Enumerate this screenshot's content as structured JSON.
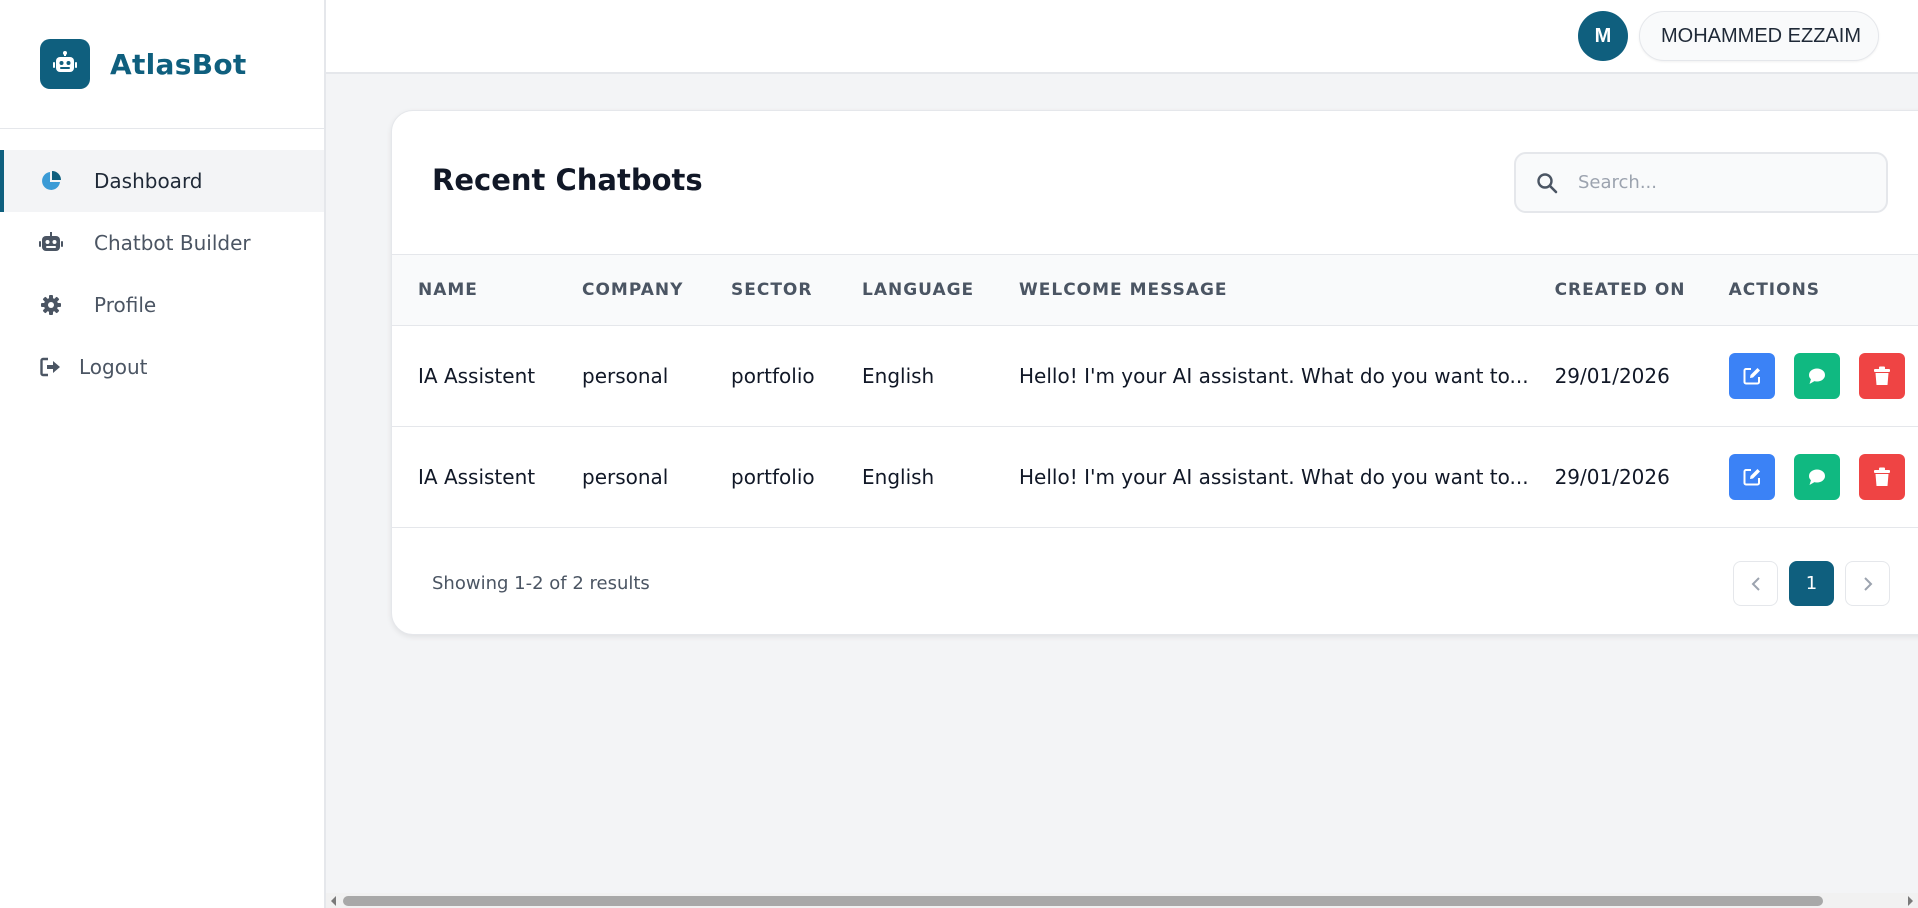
{
  "brand": {
    "name": "AtlasBot",
    "logo_icon": "robot-icon",
    "color": "#0f5f7e"
  },
  "sidebar": {
    "items": [
      {
        "label": "Dashboard",
        "icon": "pie-chart-icon",
        "active": true
      },
      {
        "label": "Chatbot Builder",
        "icon": "robot-icon",
        "active": false
      },
      {
        "label": "Profile",
        "icon": "gear-icon",
        "active": false
      },
      {
        "label": "Logout",
        "icon": "logout-icon",
        "active": false
      }
    ]
  },
  "header": {
    "avatar_initial": "M",
    "user_name": "MOHAMMED EZZAIM"
  },
  "main": {
    "title": "Recent Chatbots",
    "search": {
      "placeholder": "Search...",
      "value": ""
    },
    "table": {
      "columns": [
        "NAME",
        "COMPANY",
        "SECTOR",
        "LANGUAGE",
        "WELCOME MESSAGE",
        "CREATED ON",
        "ACTIONS"
      ],
      "rows": [
        {
          "name": "IA Assistent",
          "company": "personal",
          "sector": "portfolio",
          "language": "English",
          "welcome": "Hello! I'm your AI assistant. What do you want to...",
          "created": "29/01/2026"
        },
        {
          "name": "IA Assistent",
          "company": "personal",
          "sector": "portfolio",
          "language": "English",
          "welcome": "Hello! I'm your AI assistant. What do you want to...",
          "created": "29/01/2026"
        }
      ]
    },
    "footer": {
      "results_text": "Showing 1-2 of 2 results",
      "current_page": "1"
    }
  },
  "colors": {
    "accent": "#0f5f7e",
    "edit": "#3b82f6",
    "chat": "#10b981",
    "delete": "#ef4444"
  }
}
